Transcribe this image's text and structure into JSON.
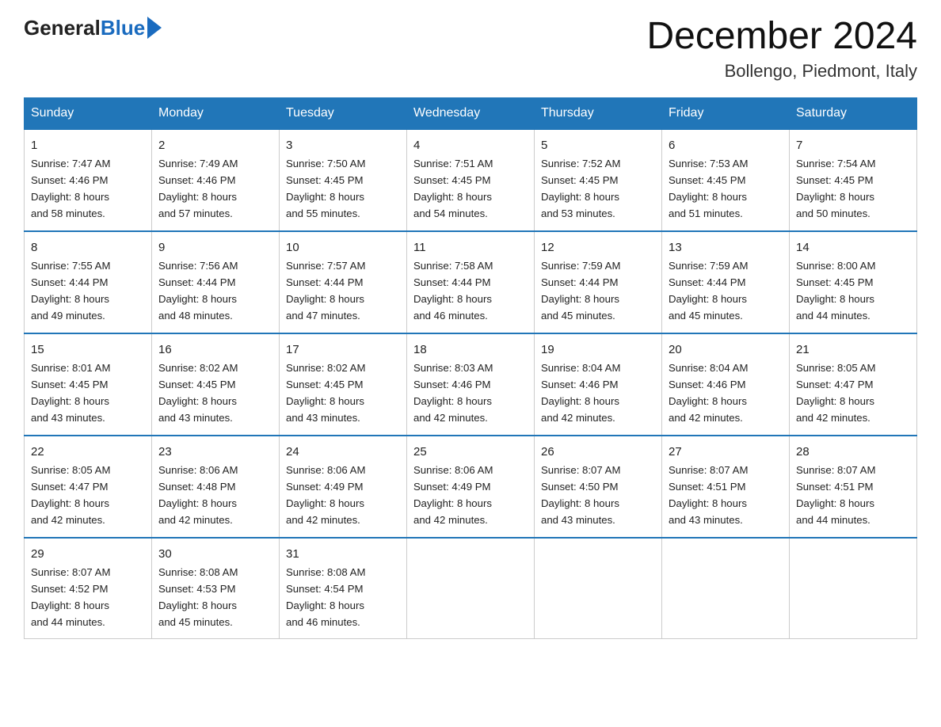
{
  "header": {
    "logo_general": "General",
    "logo_blue": "Blue",
    "month_title": "December 2024",
    "location": "Bollengo, Piedmont, Italy"
  },
  "days_of_week": [
    "Sunday",
    "Monday",
    "Tuesday",
    "Wednesday",
    "Thursday",
    "Friday",
    "Saturday"
  ],
  "weeks": [
    [
      {
        "day": "1",
        "sunrise": "7:47 AM",
        "sunset": "4:46 PM",
        "daylight": "8 hours and 58 minutes."
      },
      {
        "day": "2",
        "sunrise": "7:49 AM",
        "sunset": "4:46 PM",
        "daylight": "8 hours and 57 minutes."
      },
      {
        "day": "3",
        "sunrise": "7:50 AM",
        "sunset": "4:45 PM",
        "daylight": "8 hours and 55 minutes."
      },
      {
        "day": "4",
        "sunrise": "7:51 AM",
        "sunset": "4:45 PM",
        "daylight": "8 hours and 54 minutes."
      },
      {
        "day": "5",
        "sunrise": "7:52 AM",
        "sunset": "4:45 PM",
        "daylight": "8 hours and 53 minutes."
      },
      {
        "day": "6",
        "sunrise": "7:53 AM",
        "sunset": "4:45 PM",
        "daylight": "8 hours and 51 minutes."
      },
      {
        "day": "7",
        "sunrise": "7:54 AM",
        "sunset": "4:45 PM",
        "daylight": "8 hours and 50 minutes."
      }
    ],
    [
      {
        "day": "8",
        "sunrise": "7:55 AM",
        "sunset": "4:44 PM",
        "daylight": "8 hours and 49 minutes."
      },
      {
        "day": "9",
        "sunrise": "7:56 AM",
        "sunset": "4:44 PM",
        "daylight": "8 hours and 48 minutes."
      },
      {
        "day": "10",
        "sunrise": "7:57 AM",
        "sunset": "4:44 PM",
        "daylight": "8 hours and 47 minutes."
      },
      {
        "day": "11",
        "sunrise": "7:58 AM",
        "sunset": "4:44 PM",
        "daylight": "8 hours and 46 minutes."
      },
      {
        "day": "12",
        "sunrise": "7:59 AM",
        "sunset": "4:44 PM",
        "daylight": "8 hours and 45 minutes."
      },
      {
        "day": "13",
        "sunrise": "7:59 AM",
        "sunset": "4:44 PM",
        "daylight": "8 hours and 45 minutes."
      },
      {
        "day": "14",
        "sunrise": "8:00 AM",
        "sunset": "4:45 PM",
        "daylight": "8 hours and 44 minutes."
      }
    ],
    [
      {
        "day": "15",
        "sunrise": "8:01 AM",
        "sunset": "4:45 PM",
        "daylight": "8 hours and 43 minutes."
      },
      {
        "day": "16",
        "sunrise": "8:02 AM",
        "sunset": "4:45 PM",
        "daylight": "8 hours and 43 minutes."
      },
      {
        "day": "17",
        "sunrise": "8:02 AM",
        "sunset": "4:45 PM",
        "daylight": "8 hours and 43 minutes."
      },
      {
        "day": "18",
        "sunrise": "8:03 AM",
        "sunset": "4:46 PM",
        "daylight": "8 hours and 42 minutes."
      },
      {
        "day": "19",
        "sunrise": "8:04 AM",
        "sunset": "4:46 PM",
        "daylight": "8 hours and 42 minutes."
      },
      {
        "day": "20",
        "sunrise": "8:04 AM",
        "sunset": "4:46 PM",
        "daylight": "8 hours and 42 minutes."
      },
      {
        "day": "21",
        "sunrise": "8:05 AM",
        "sunset": "4:47 PM",
        "daylight": "8 hours and 42 minutes."
      }
    ],
    [
      {
        "day": "22",
        "sunrise": "8:05 AM",
        "sunset": "4:47 PM",
        "daylight": "8 hours and 42 minutes."
      },
      {
        "day": "23",
        "sunrise": "8:06 AM",
        "sunset": "4:48 PM",
        "daylight": "8 hours and 42 minutes."
      },
      {
        "day": "24",
        "sunrise": "8:06 AM",
        "sunset": "4:49 PM",
        "daylight": "8 hours and 42 minutes."
      },
      {
        "day": "25",
        "sunrise": "8:06 AM",
        "sunset": "4:49 PM",
        "daylight": "8 hours and 42 minutes."
      },
      {
        "day": "26",
        "sunrise": "8:07 AM",
        "sunset": "4:50 PM",
        "daylight": "8 hours and 43 minutes."
      },
      {
        "day": "27",
        "sunrise": "8:07 AM",
        "sunset": "4:51 PM",
        "daylight": "8 hours and 43 minutes."
      },
      {
        "day": "28",
        "sunrise": "8:07 AM",
        "sunset": "4:51 PM",
        "daylight": "8 hours and 44 minutes."
      }
    ],
    [
      {
        "day": "29",
        "sunrise": "8:07 AM",
        "sunset": "4:52 PM",
        "daylight": "8 hours and 44 minutes."
      },
      {
        "day": "30",
        "sunrise": "8:08 AM",
        "sunset": "4:53 PM",
        "daylight": "8 hours and 45 minutes."
      },
      {
        "day": "31",
        "sunrise": "8:08 AM",
        "sunset": "4:54 PM",
        "daylight": "8 hours and 46 minutes."
      },
      null,
      null,
      null,
      null
    ]
  ]
}
